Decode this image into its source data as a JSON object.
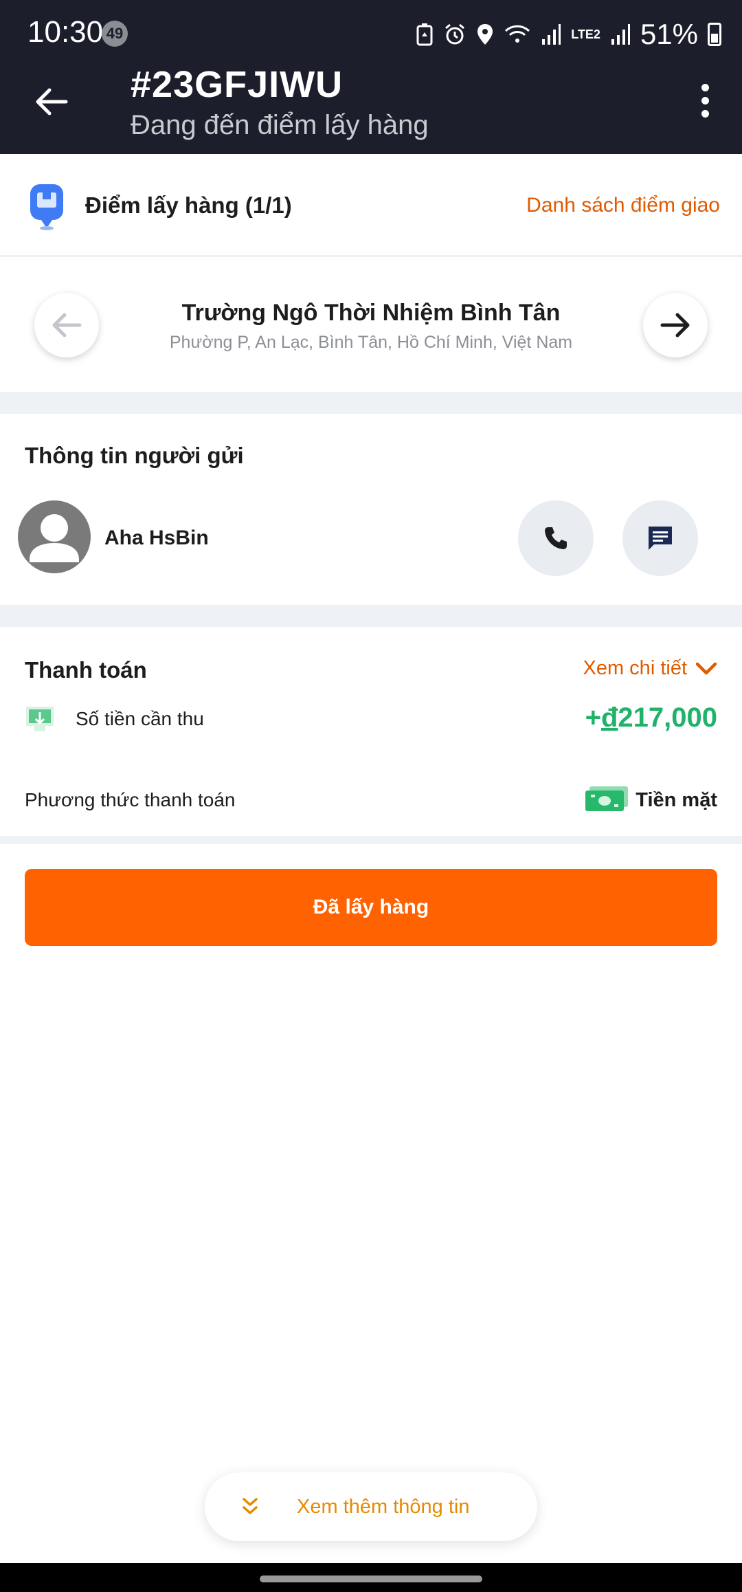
{
  "status_bar": {
    "time": "10:30",
    "notification_count": "49",
    "battery_percent": "51%",
    "network_label": "LTE2",
    "icons": [
      "battery-saver-icon",
      "alarm-icon",
      "location-icon",
      "wifi-icon",
      "signal-icon",
      "volte-icon",
      "signal-icon",
      "battery-icon"
    ]
  },
  "header": {
    "order_id": "#23GFJIWU",
    "status": "Đang đến điểm lấy hàng"
  },
  "pickup": {
    "label": "Điểm lấy hàng (1/1)",
    "list_link": "Danh sách điểm giao"
  },
  "address": {
    "name": "Trường Ngô Thời Nhiệm Bình Tân",
    "detail": "Phường P, An Lạc, Bình Tân, Hồ Chí Minh, Việt Nam"
  },
  "sender": {
    "section_title": "Thông tin người gửi",
    "name": "Aha HsBin"
  },
  "payment": {
    "section_title": "Thanh toán",
    "detail_link": "Xem chi tiết",
    "amount_label": "Số tiền cần thu",
    "amount_prefix": "+",
    "amount_currency": "đ",
    "amount_value": "217,000",
    "method_label": "Phương thức thanh toán",
    "method_value": "Tiền mặt"
  },
  "actions": {
    "confirm_label": "Đã lấy hàng",
    "more_info_label": "Xem thêm thông tin"
  },
  "colors": {
    "header_bg": "#1c1f2b",
    "accent_orange": "#ff6200",
    "link_orange": "#e05a00",
    "amount_green": "#20b26b",
    "section_band": "#eef1f5"
  }
}
